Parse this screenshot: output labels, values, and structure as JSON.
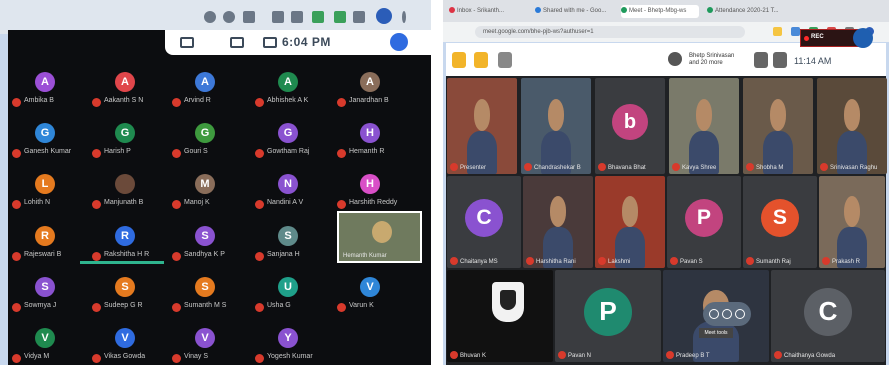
{
  "left": {
    "time": "6:04 PM",
    "participants": [
      {
        "letter": "A",
        "color": "#9b4fd6",
        "name": "Ambika B"
      },
      {
        "letter": "A",
        "color": "#e0464b",
        "name": "Aakanth S N"
      },
      {
        "letter": "A",
        "color": "#3d78d8",
        "name": "Arvind R"
      },
      {
        "letter": "A",
        "color": "#1f8a4f",
        "name": "Abhishek A K"
      },
      {
        "letter": "A",
        "color": "#8a6d5a",
        "name": "Janardhan B"
      },
      {
        "letter": "G",
        "color": "#2f86d8",
        "name": "Ganesh Kumar"
      },
      {
        "letter": "G",
        "color": "#1f8a4f",
        "name": "Harish P"
      },
      {
        "letter": "G",
        "color": "#3e9a3e",
        "name": "Gouri S"
      },
      {
        "letter": "G",
        "color": "#8a52d0",
        "name": "Gowtham Raj"
      },
      {
        "letter": "H",
        "color": "#8a52d0",
        "name": "Hemanth R"
      },
      {
        "letter": "L",
        "color": "#e57a1f",
        "name": "Lohith N"
      },
      {
        "letter": "",
        "color": "#6b4a3a",
        "name": "Manjunath B"
      },
      {
        "letter": "M",
        "color": "#8a6d5a",
        "name": "Manoj K"
      },
      {
        "letter": "N",
        "color": "#8a52d0",
        "name": "Nandini A V"
      },
      {
        "letter": "H",
        "color": "#d94fc7",
        "name": "Harshith Reddy"
      },
      {
        "letter": "R",
        "color": "#e57a1f",
        "name": "Rajeswari B"
      },
      {
        "letter": "R",
        "color": "#2f6be0",
        "name": "Rakshitha H R"
      },
      {
        "letter": "S",
        "color": "#8a52d0",
        "name": "Sandhya K P"
      },
      {
        "letter": "S",
        "color": "#5f8a8a",
        "name": "Sanjana H"
      },
      {
        "letter": "S",
        "color": "#8a52d0",
        "name": "Sowmya J"
      },
      {
        "letter": "S",
        "color": "#e57a1f",
        "name": "Sudeep G R"
      },
      {
        "letter": "S",
        "color": "#e57a1f",
        "name": "Sumanth M S"
      },
      {
        "letter": "U",
        "color": "#1fa08a",
        "name": "Usha G"
      },
      {
        "letter": "V",
        "color": "#2f86d8",
        "name": "Varun K"
      },
      {
        "letter": "V",
        "color": "#1f8a4f",
        "name": "Vidya M"
      },
      {
        "letter": "V",
        "color": "#2f6be0",
        "name": "Vikas Gowda"
      },
      {
        "letter": "V",
        "color": "#8a52d0",
        "name": "Vinay S"
      },
      {
        "letter": "Y",
        "color": "#8a52d0",
        "name": "Yogesh Kumar"
      }
    ],
    "video_tile": {
      "name": "Hemanth Kumar"
    }
  },
  "right": {
    "tabs": [
      "Inbox - Srikanth...",
      "Shared with me - Goo...",
      "Meet - Bhetp-Mbg-ws",
      "Attendance 2020-21 T..."
    ],
    "url": "meet.google.com/bhe-pjb-ws?authuser=1",
    "presenter": [
      "Bhetp Srinivasan",
      "and 20 more"
    ],
    "time": "11:14 AM",
    "recording_label": "REC",
    "tooltip": "Meet tools",
    "participants": [
      {
        "name": "Presenter"
      },
      {
        "name": "Chandrashekar B"
      },
      {
        "name": "Bhavana Bhat",
        "letter": "b",
        "color": "#c2447f"
      },
      {
        "name": "Kavya Shree"
      },
      {
        "name": "Shobha M"
      },
      {
        "name": "Srinivasan Raghu"
      },
      {
        "name": "Chaitanya MS",
        "letter": "C",
        "color": "#8a52d0"
      },
      {
        "name": "Harshitha Rani"
      },
      {
        "name": "Lakshmi"
      },
      {
        "name": "Pavan S",
        "letter": "P",
        "color": "#c2447f"
      },
      {
        "name": "Sumanth Raj",
        "letter": "S",
        "color": "#e4522c"
      },
      {
        "name": "Prakash R"
      },
      {
        "name": "Bhuvan K"
      },
      {
        "name": "Pavan N",
        "letter": "P",
        "color": "#1f8a6f"
      },
      {
        "name": "Pradeep B T"
      },
      {
        "name": "Chaithanya Gowda",
        "letter": "C",
        "color": "#5c6066"
      }
    ]
  }
}
